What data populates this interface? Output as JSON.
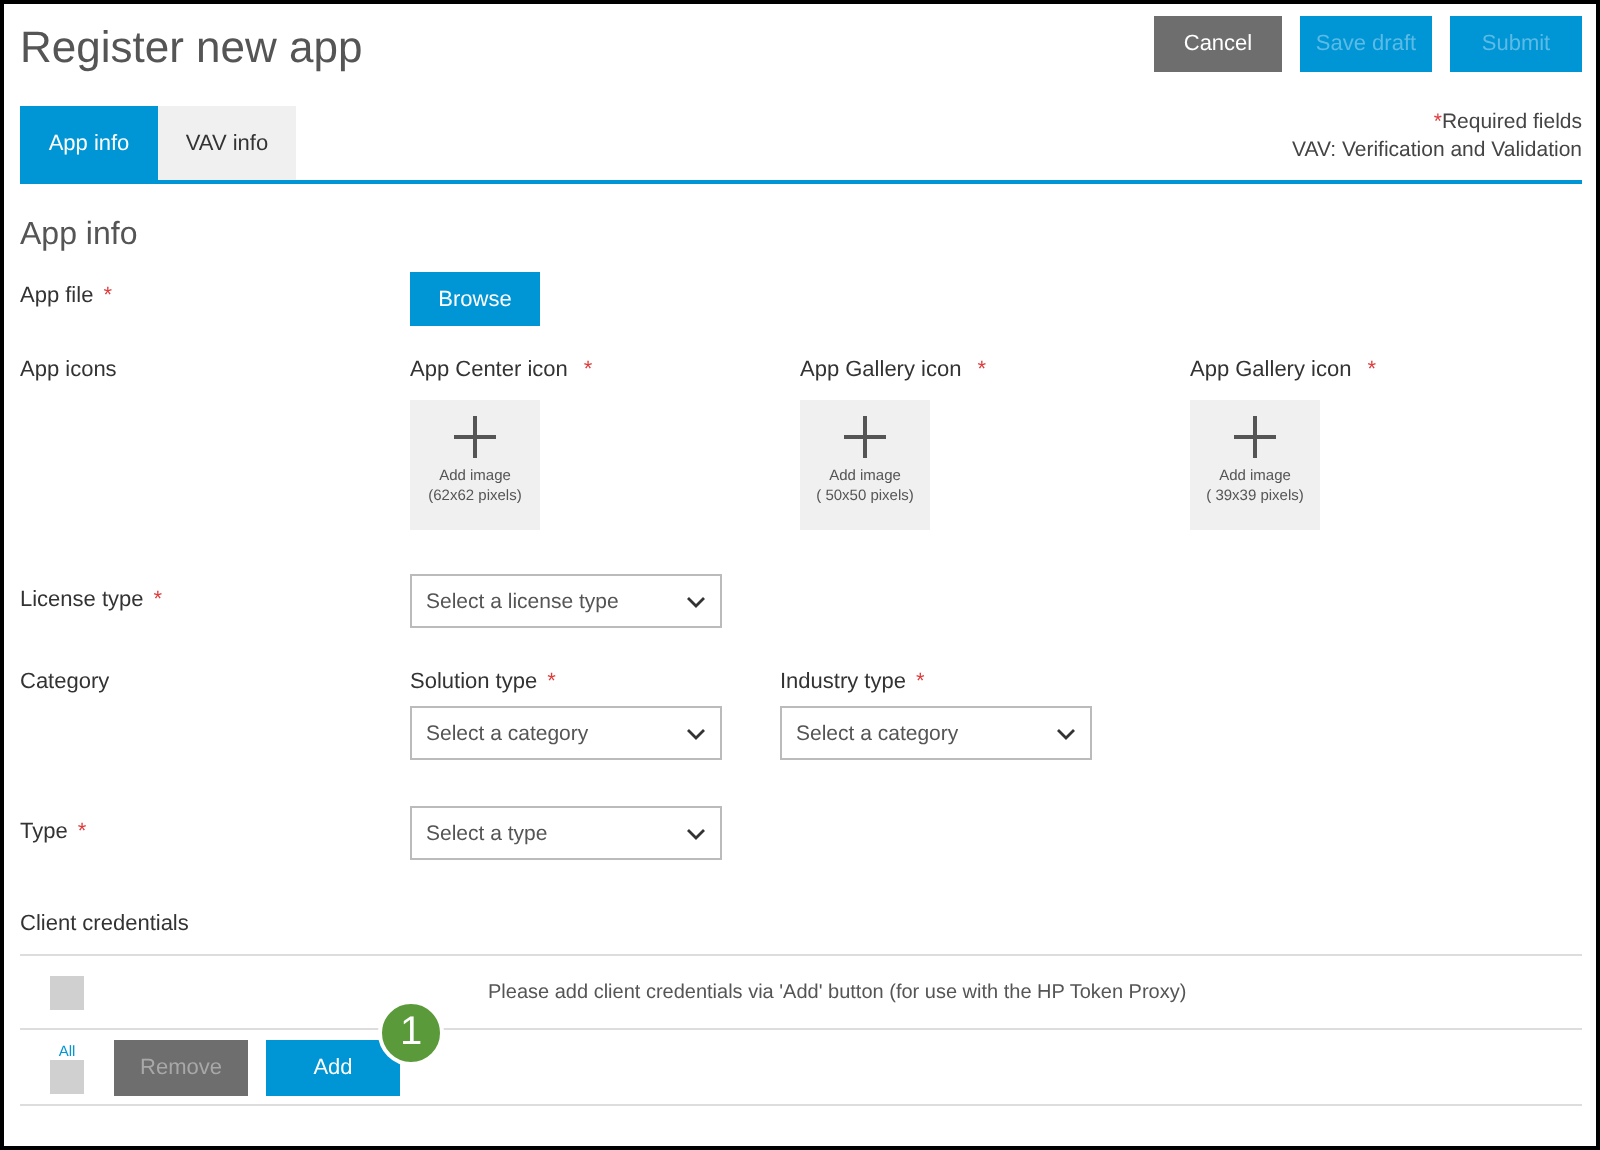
{
  "title": "Register new app",
  "actions": [
    {
      "label": "Cancel",
      "kind": "secondary",
      "disabled": false
    },
    {
      "label": "Save draft",
      "kind": "primary",
      "disabled": true
    },
    {
      "label": "Submit",
      "kind": "primary",
      "disabled": true
    }
  ],
  "tabs": [
    {
      "label": "App info",
      "selected": true
    },
    {
      "label": "VAV info",
      "selected": false
    }
  ],
  "notes": {
    "required_mark": "*",
    "required_text": "Required fields",
    "legend": "VAV: Verification and Validation"
  },
  "section_title": "App info",
  "app_file": {
    "label": "App file",
    "mark": "*",
    "button": "Browse"
  },
  "app_icons": {
    "label": "App icons",
    "slots": [
      {
        "label": "App Center icon",
        "mark": "*",
        "text": "Add image",
        "size": "(62x62 pixels)"
      },
      {
        "label": "App Gallery icon",
        "mark": "*",
        "text": "Add image",
        "size": "( 50x50 pixels)"
      },
      {
        "label": "App Gallery icon",
        "mark": "*",
        "text": "Add image",
        "size": "( 39x39 pixels)"
      }
    ]
  },
  "license": {
    "label": "License type",
    "mark": "*",
    "placeholder": "Select a license type"
  },
  "category": {
    "label": "Category",
    "fields": [
      {
        "label": "Solution type",
        "mark": "*",
        "placeholder": "Select a category"
      },
      {
        "label": "Industry type",
        "mark": "*",
        "placeholder": "Select a category"
      }
    ]
  },
  "type": {
    "label": "Type",
    "mark": "*",
    "placeholder": "Select a type"
  },
  "client_credentials": {
    "label": "Client credentials",
    "checked": false,
    "message": "Please add client credentials via 'Add' button (for use with the HP Token Proxy)",
    "all_label": "All",
    "all_checked": false,
    "remove": {
      "label": "Remove",
      "disabled": true
    },
    "add": {
      "label": "Add",
      "disabled": false
    }
  },
  "callout": "1"
}
